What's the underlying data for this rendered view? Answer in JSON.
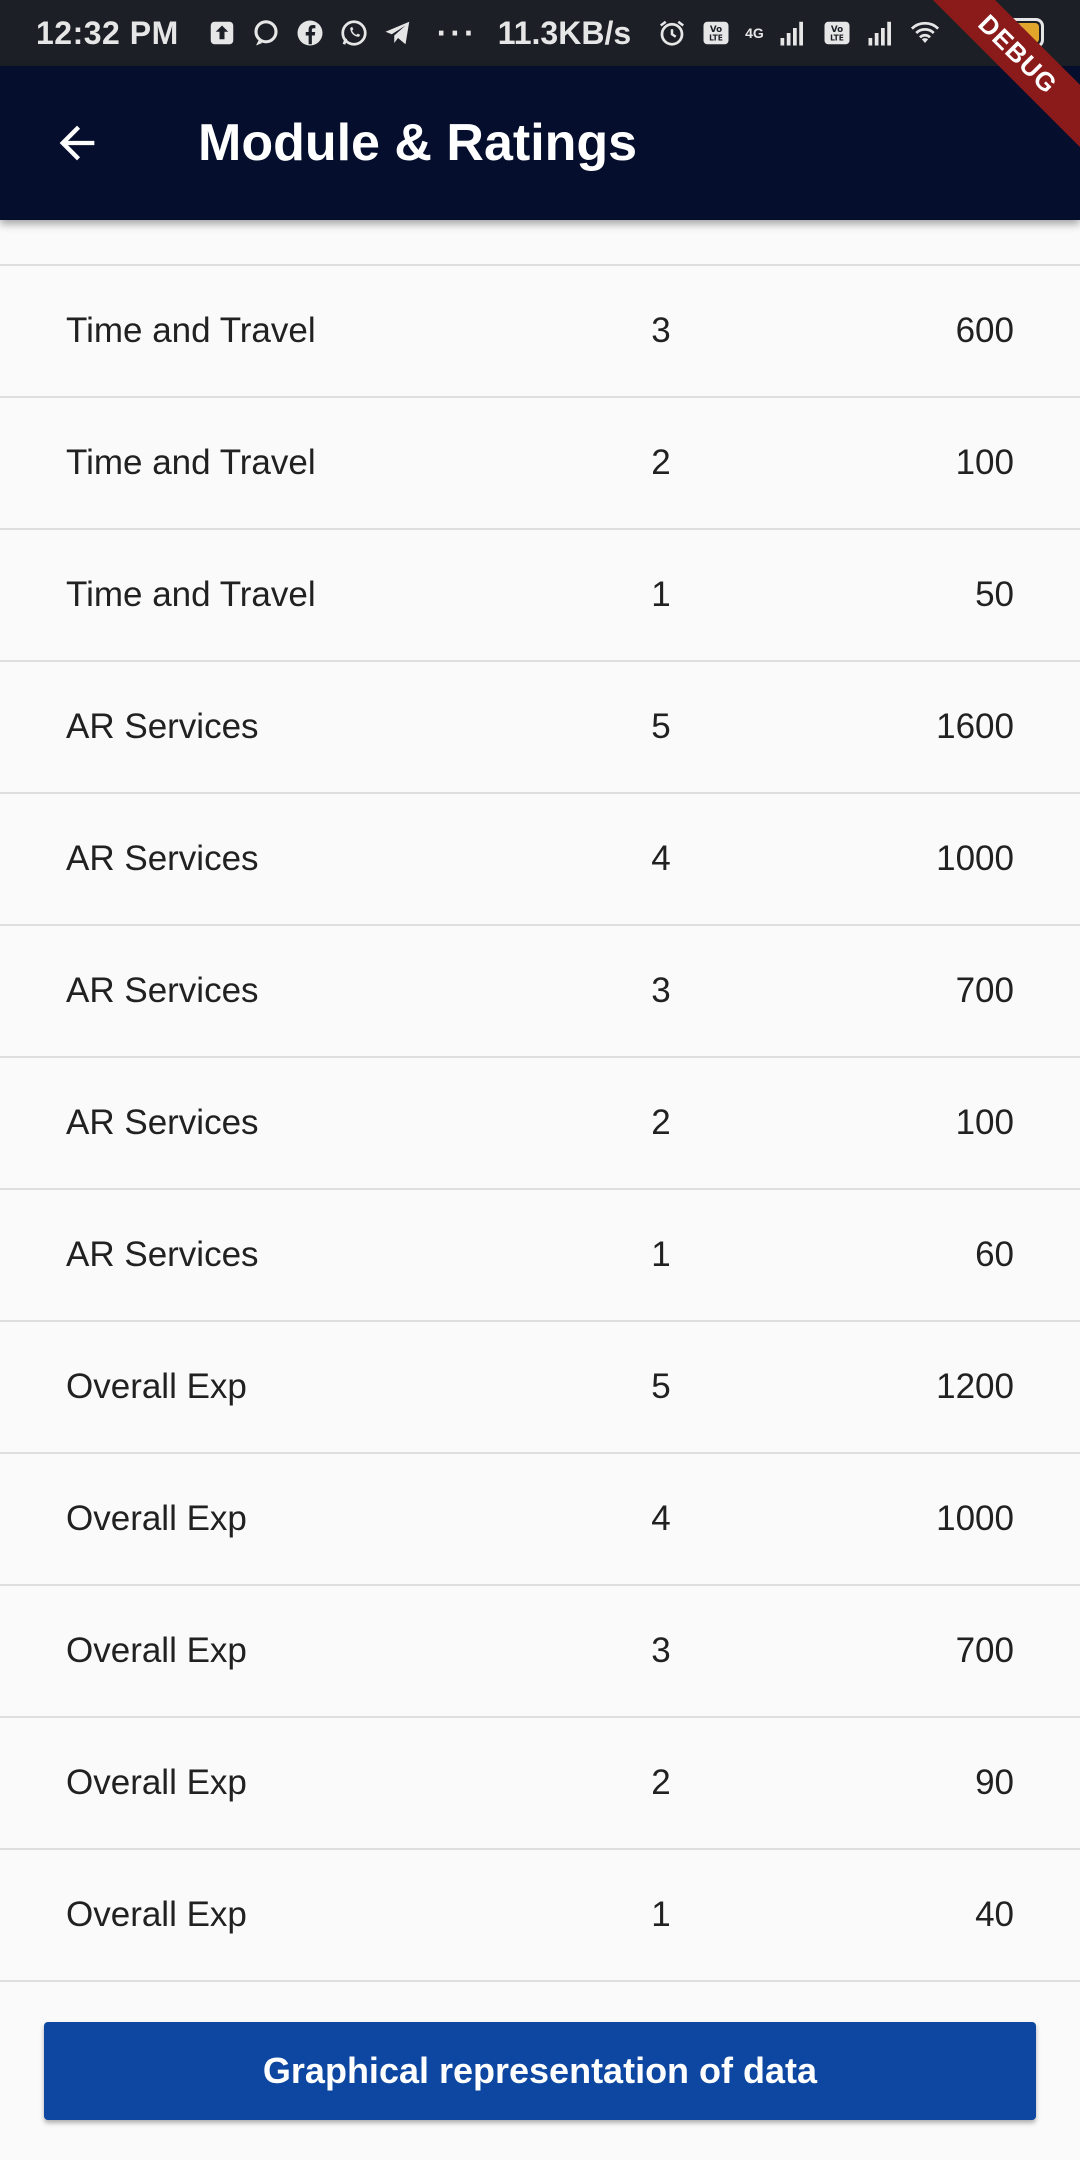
{
  "status_bar": {
    "time": "12:32 PM",
    "dots": "···",
    "speed": "11.3KB/s",
    "network_label": "4G",
    "battery": "90",
    "icons": [
      "upload-icon",
      "chat-bubble-icon",
      "facebook-icon",
      "whatsapp-icon",
      "telegram-icon",
      "alarm-icon",
      "volte-icon",
      "signal-icon",
      "volte-icon",
      "signal-icon",
      "wifi-icon",
      "battery-icon"
    ]
  },
  "header": {
    "title": "Module & Ratings",
    "back_icon": "arrow-back-icon"
  },
  "debug_banner": "DEBUG",
  "table": {
    "rows": [
      {
        "module": "Time and Travel",
        "rating": "3",
        "count": "600"
      },
      {
        "module": "Time and Travel",
        "rating": "2",
        "count": "100"
      },
      {
        "module": "Time and Travel",
        "rating": "1",
        "count": "50"
      },
      {
        "module": "AR Services",
        "rating": "5",
        "count": "1600"
      },
      {
        "module": "AR Services",
        "rating": "4",
        "count": "1000"
      },
      {
        "module": "AR Services",
        "rating": "3",
        "count": "700"
      },
      {
        "module": "AR Services",
        "rating": "2",
        "count": "100"
      },
      {
        "module": "AR Services",
        "rating": "1",
        "count": "60"
      },
      {
        "module": "Overall Exp",
        "rating": "5",
        "count": "1200"
      },
      {
        "module": "Overall Exp",
        "rating": "4",
        "count": "1000"
      },
      {
        "module": "Overall Exp",
        "rating": "3",
        "count": "700"
      },
      {
        "module": "Overall Exp",
        "rating": "2",
        "count": "90"
      },
      {
        "module": "Overall Exp",
        "rating": "1",
        "count": "40"
      }
    ]
  },
  "footer": {
    "button_label": "Graphical representation of data"
  },
  "colors": {
    "app_bar": "#050e2d",
    "status_bar": "#1c1f26",
    "button": "#0d47a1",
    "background": "#fafafa",
    "divider": "#dedede",
    "debug_ribbon": "#8b1a1a"
  }
}
